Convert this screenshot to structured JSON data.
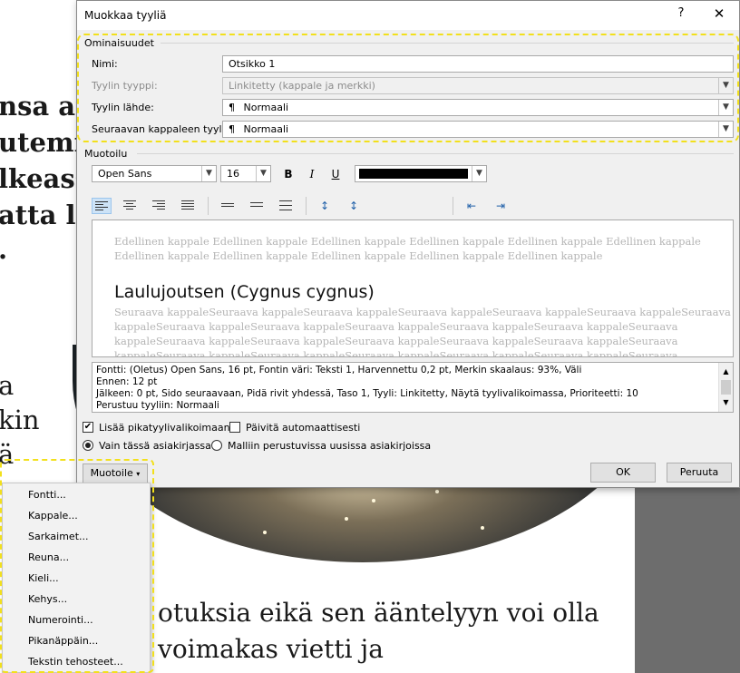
{
  "background": {
    "left_lines": [
      "nsa ar",
      "utemn",
      "lkeass",
      "atta la",
      "."
    ],
    "mid_lines": [
      "a",
      "kin",
      "ä"
    ],
    "lower_lines": [
      "otuksia eikä sen ääntelyyn voi olla",
      "voimakas vietti ja"
    ]
  },
  "dialog": {
    "title": "Muokkaa tyyliä",
    "help": "?",
    "close": "✕",
    "properties_group": "Ominaisuudet",
    "name_label": "Nimi:",
    "name_value": "Otsikko 1",
    "type_label": "Tyylin tyyppi:",
    "type_value": "Linkitetty (kappale ja merkki)",
    "based_on_label": "Tyylin lähde:",
    "based_on_value": "Normaali",
    "next_label": "Seuraavan kappaleen tyyli:",
    "next_value": "Normaali",
    "paragraph_symbol": "¶",
    "formatting_group": "Muotoilu",
    "font_value": "Open Sans",
    "size_value": "16",
    "bold": "B",
    "italic": "I",
    "underline": "U",
    "color_value": "#000000",
    "preview": {
      "previous_lines": [
        "Edellinen kappale Edellinen kappale Edellinen kappale Edellinen kappale Edellinen kappale Edellinen kappale",
        "Edellinen kappale Edellinen kappale Edellinen kappale Edellinen kappale Edellinen kappale"
      ],
      "heading": "Laulujoutsen (Cygnus cygnus)",
      "next_lines": [
        "Seuraava kappaleSeuraava kappaleSeuraava kappaleSeuraava kappaleSeuraava kappaleSeuraava kappaleSeuraava",
        "kappaleSeuraava kappaleSeuraava kappaleSeuraava kappaleSeuraava kappaleSeuraava kappaleSeuraava",
        "kappaleSeuraava kappaleSeuraava kappaleSeuraava kappaleSeuraava kappaleSeuraava kappaleSeuraava",
        "kappaleSeuraava kappaleSeuraava kappaleSeuraava kappaleSeuraava kappaleSeuraava kappaleSeuraava"
      ]
    },
    "description_lines": [
      "Fontti: (Oletus) Open Sans, 16 pt, Fontin väri: Teksti 1, Harvennettu  0,2 pt, Merkin skaalaus: 93%, Väli",
      "    Ennen:  12 pt",
      "    Jälkeen:  0 pt, Sido seuraavaan, Pidä rivit yhdessä, Taso 1, Tyyli: Linkitetty, Näytä tyylivalikoimassa, Prioriteetti: 10",
      "    Perustuu tyyliin: Normaali"
    ],
    "add_quick_styles": "Lisää pikatyylivalikoimaan",
    "add_quick_styles_checked": true,
    "auto_update": "Päivitä automaattisesti",
    "auto_update_checked": false,
    "only_this_doc": "Vain tässä asiakirjassa",
    "new_docs": "Malliin perustuvissa uusissa asiakirjoissa",
    "format_button": "Muotoile",
    "ok": "OK",
    "cancel": "Peruuta"
  },
  "format_menu": {
    "items": [
      "Fontti...",
      "Kappale...",
      "Sarkaimet...",
      "Reuna...",
      "Kieli...",
      "Kehys...",
      "Numerointi...",
      "Pikanäppäin...",
      "Tekstin tehosteet..."
    ]
  },
  "colors": {
    "highlight": "#f2e01c",
    "selected_align": "#cde3f7"
  }
}
